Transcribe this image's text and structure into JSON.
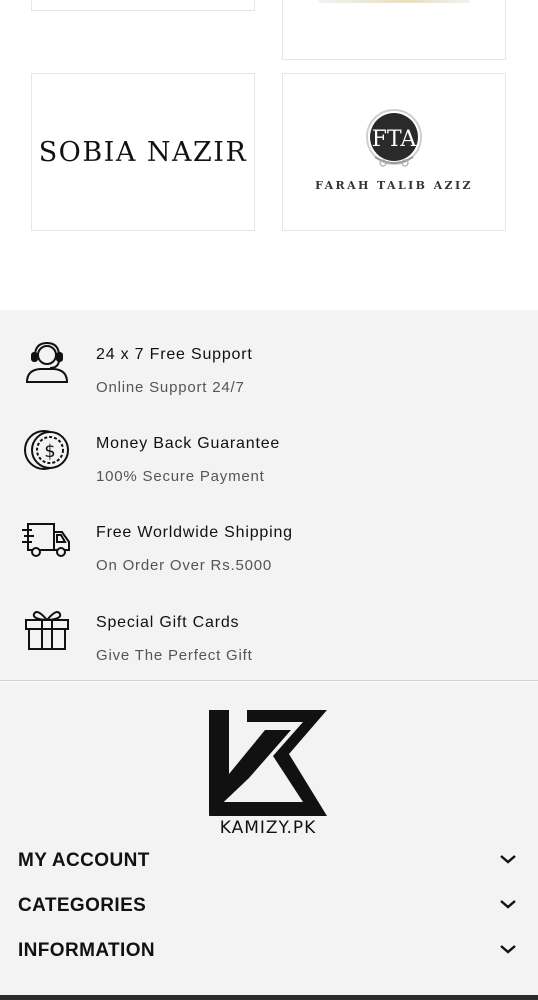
{
  "brands": {
    "sobia_nazir": "SOBIA NAZIR",
    "farah_talib_aziz": "FARAH TALIB AZIZ",
    "fta_monogram": "FTA"
  },
  "features": [
    {
      "icon": "customer-support-icon",
      "title": "24 x 7 Free Support",
      "subtitle": "Online Support 24/7"
    },
    {
      "icon": "money-back-icon",
      "title": "Money Back Guarantee",
      "subtitle": "100% Secure Payment"
    },
    {
      "icon": "shipping-truck-icon",
      "title": "Free Worldwide Shipping",
      "subtitle": "On Order Over Rs.5000"
    },
    {
      "icon": "gift-box-icon",
      "title": "Special Gift Cards",
      "subtitle": "Give The Perfect Gift"
    }
  ],
  "footer": {
    "logo_text": "KAMIZY.PK",
    "sections": [
      {
        "label": "MY ACCOUNT"
      },
      {
        "label": "CATEGORIES"
      },
      {
        "label": "INFORMATION"
      }
    ]
  }
}
